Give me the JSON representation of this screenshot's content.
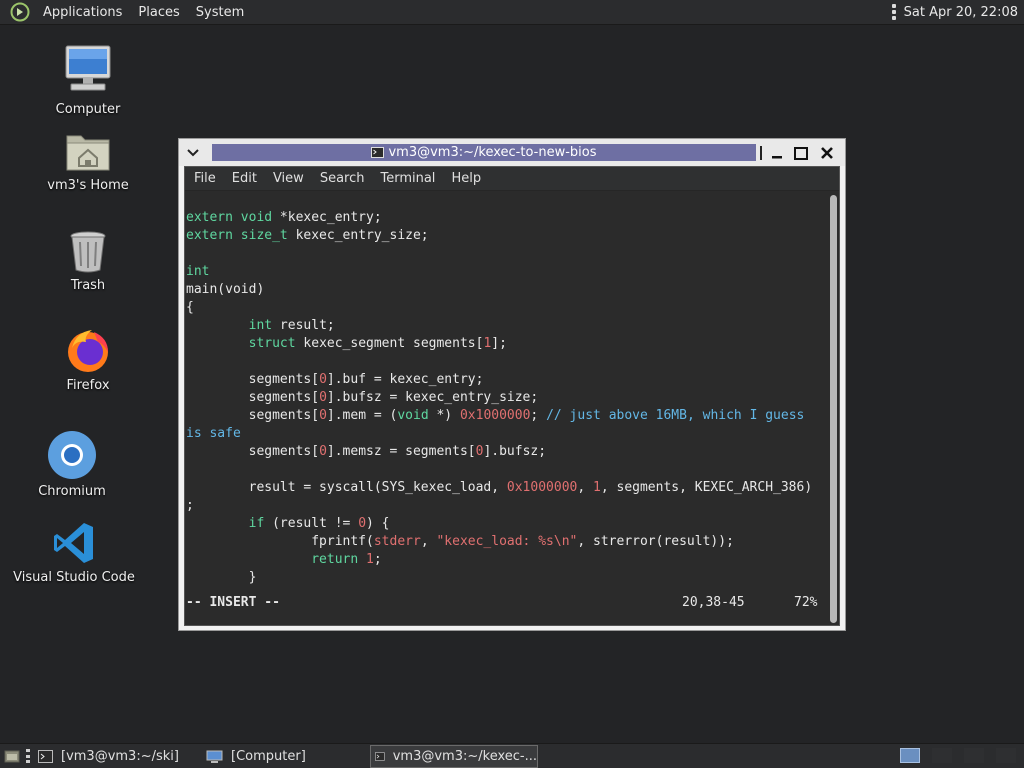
{
  "top_panel": {
    "menus": [
      "Applications",
      "Places",
      "System"
    ],
    "clock": "Sat Apr 20, 22:08"
  },
  "desktop_icons": [
    {
      "label": "Computer"
    },
    {
      "label": "vm3's Home"
    },
    {
      "label": "Trash"
    },
    {
      "label": "Firefox"
    },
    {
      "label": "Chromium"
    },
    {
      "label": "Visual Studio Code"
    }
  ],
  "window": {
    "title": "vm3@vm3:~/kexec-to-new-bios",
    "menus": [
      "File",
      "Edit",
      "View",
      "Search",
      "Terminal",
      "Help"
    ]
  },
  "code_lines": [
    [
      [
        "ty",
        "extern void"
      ],
      [
        "plain",
        " *kexec_entry;"
      ]
    ],
    [
      [
        "ty",
        "extern size_t"
      ],
      [
        "plain",
        " kexec_entry_size;"
      ]
    ],
    [],
    [
      [
        "ty",
        "int"
      ]
    ],
    [
      [
        "plain",
        "main(void)"
      ]
    ],
    [
      [
        "plain",
        "{"
      ]
    ],
    [
      [
        "plain",
        "        "
      ],
      [
        "ty",
        "int"
      ],
      [
        "plain",
        " result;"
      ]
    ],
    [
      [
        "plain",
        "        "
      ],
      [
        "ty",
        "struct"
      ],
      [
        "plain",
        " kexec_segment segments["
      ],
      [
        "num",
        "1"
      ],
      [
        "plain",
        "];"
      ]
    ],
    [],
    [
      [
        "plain",
        "        segments["
      ],
      [
        "num",
        "0"
      ],
      [
        "plain",
        "].buf = kexec_entry;"
      ]
    ],
    [
      [
        "plain",
        "        segments["
      ],
      [
        "num",
        "0"
      ],
      [
        "plain",
        "].bufsz = kexec_entry_size;"
      ]
    ],
    [
      [
        "plain",
        "        segments["
      ],
      [
        "num",
        "0"
      ],
      [
        "plain",
        "].mem = ("
      ],
      [
        "ty",
        "void"
      ],
      [
        "plain",
        " *) "
      ],
      [
        "num",
        "0x1000000"
      ],
      [
        "plain",
        "; "
      ],
      [
        "cmt",
        "// just above 16MB, which I guess"
      ]
    ],
    [
      [
        "cmt",
        "is safe"
      ]
    ],
    [
      [
        "plain",
        "        segments["
      ],
      [
        "num",
        "0"
      ],
      [
        "plain",
        "].memsz = segments["
      ],
      [
        "num",
        "0"
      ],
      [
        "plain",
        "].bufsz;"
      ]
    ],
    [],
    [
      [
        "plain",
        "        result = syscall(SYS_kexec_load, "
      ],
      [
        "num",
        "0x1000000"
      ],
      [
        "plain",
        ", "
      ],
      [
        "num",
        "1"
      ],
      [
        "plain",
        ", segments, KEXEC_ARCH_386)"
      ]
    ],
    [
      [
        "plain",
        ";"
      ]
    ],
    [
      [
        "plain",
        "        "
      ],
      [
        "kw",
        "if"
      ],
      [
        "plain",
        " (result != "
      ],
      [
        "num",
        "0"
      ],
      [
        "plain",
        ") {"
      ]
    ],
    [
      [
        "plain",
        "                fprintf("
      ],
      [
        "num",
        "stderr"
      ],
      [
        "plain",
        ", "
      ],
      [
        "str",
        "\"kexec_load: "
      ],
      [
        "num",
        "%s\\n"
      ],
      [
        "str",
        "\""
      ],
      [
        "plain",
        ", strerror(result));"
      ]
    ],
    [
      [
        "plain",
        "                "
      ],
      [
        "kw",
        "return"
      ],
      [
        "plain",
        " "
      ],
      [
        "num",
        "1"
      ],
      [
        "plain",
        ";"
      ]
    ],
    [
      [
        "plain",
        "        }"
      ]
    ]
  ],
  "status": {
    "mode": "-- INSERT --",
    "position": "20,38-45",
    "percent": "72%"
  },
  "taskbar": {
    "tasks": [
      {
        "label": "[vm3@vm3:~/ski]"
      },
      {
        "label": "[Computer]"
      },
      {
        "label": "vm3@vm3:~/kexec-..."
      }
    ]
  }
}
